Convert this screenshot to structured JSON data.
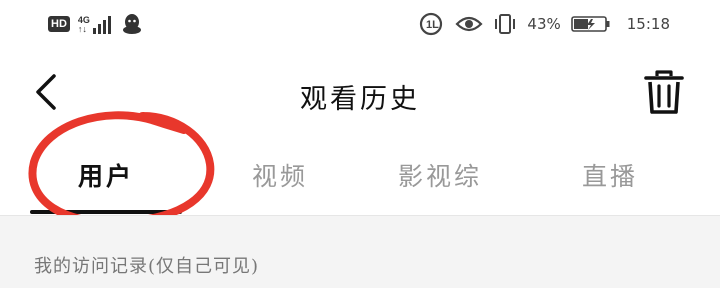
{
  "status_bar": {
    "hd": "HD",
    "network_gen": "4G",
    "network_sub": "↑↓",
    "battery_percent": "43%",
    "time": "15:18",
    "icons": [
      "hd-badge",
      "signal-icon",
      "qq-icon",
      "nfc-icon",
      "eye-icon",
      "vibrate-icon",
      "battery-icon"
    ]
  },
  "header": {
    "title": "观看历史",
    "back_icon": "chevron-left-icon",
    "delete_icon": "trash-icon"
  },
  "tabs": [
    {
      "label": "用户",
      "active": true
    },
    {
      "label": "视频",
      "active": false
    },
    {
      "label": "影视综",
      "active": false
    },
    {
      "label": "直播",
      "active": false
    }
  ],
  "content": {
    "section_label": "我的访问记录(仅自己可见)"
  },
  "colors": {
    "annotation_red": "#e8372c",
    "active_tab": "#111111",
    "inactive_tab": "#999999",
    "content_bg": "#f4f4f4"
  }
}
